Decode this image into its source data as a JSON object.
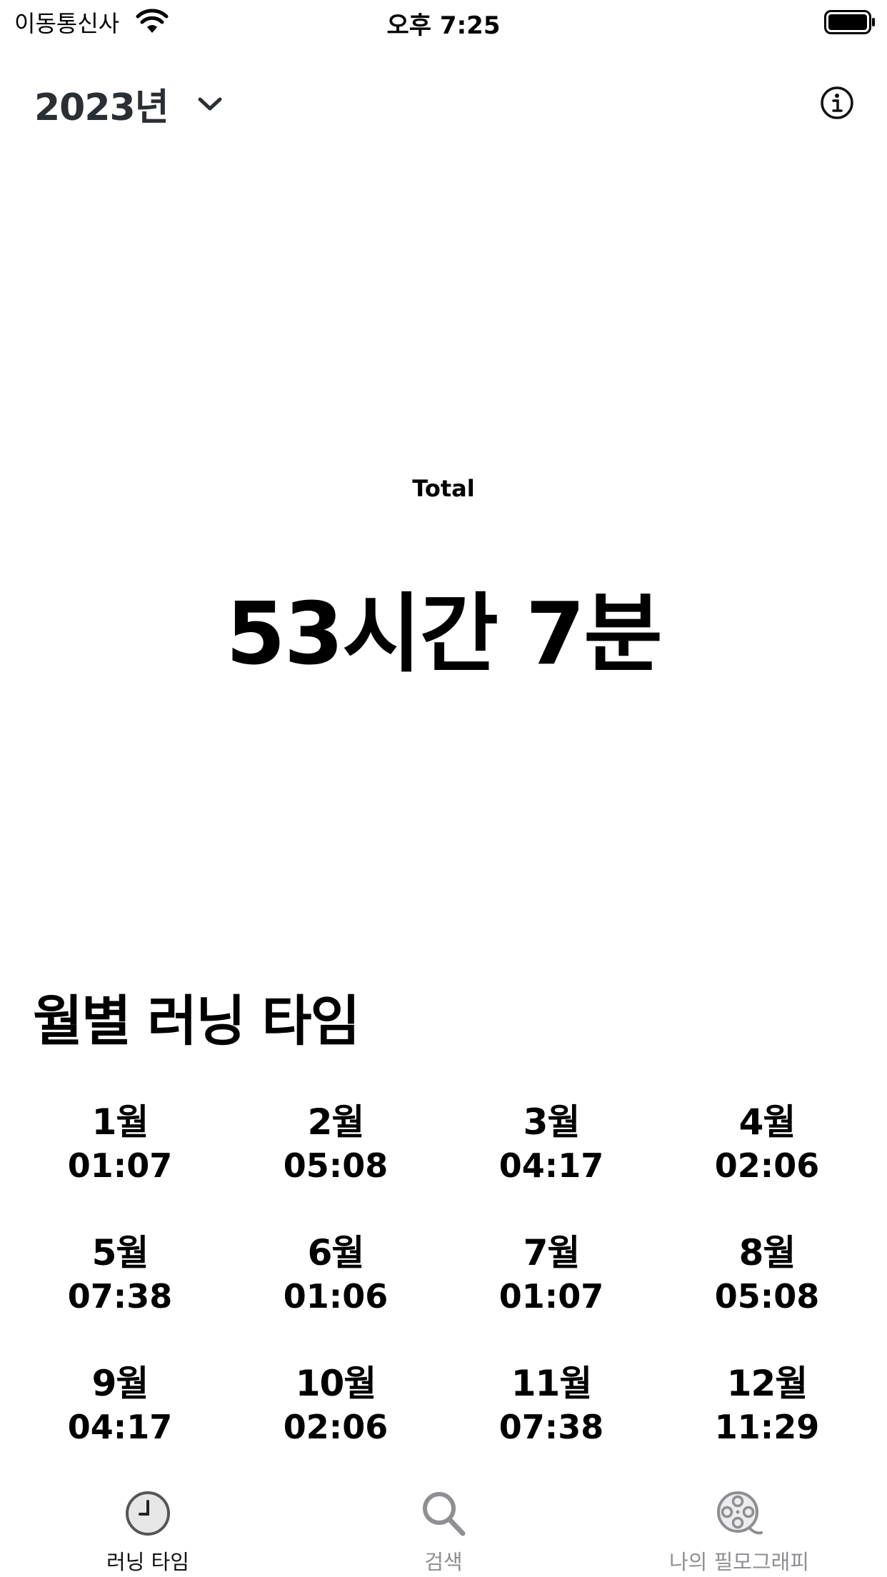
{
  "status_bar": {
    "carrier": "이동통신사",
    "time": "오후 7:25"
  },
  "header": {
    "year": "2023년"
  },
  "summary": {
    "caption": "Total",
    "value": "53시간 7분"
  },
  "monthly": {
    "title": "월별 러닝 타임",
    "months": [
      {
        "name": "1월",
        "time": "01:07"
      },
      {
        "name": "2월",
        "time": "05:08"
      },
      {
        "name": "3월",
        "time": "04:17"
      },
      {
        "name": "4월",
        "time": "02:06"
      },
      {
        "name": "5월",
        "time": "07:38"
      },
      {
        "name": "6월",
        "time": "01:06"
      },
      {
        "name": "7월",
        "time": "01:07"
      },
      {
        "name": "8월",
        "time": "05:08"
      },
      {
        "name": "9월",
        "time": "04:17"
      },
      {
        "name": "10월",
        "time": "02:06"
      },
      {
        "name": "11월",
        "time": "07:38"
      },
      {
        "name": "12월",
        "time": "11:29"
      }
    ]
  },
  "tabs": [
    {
      "label": "러닝 타임",
      "icon": "clock-icon",
      "active": true
    },
    {
      "label": "검색",
      "icon": "search-icon",
      "active": false
    },
    {
      "label": "나의 필모그래피",
      "icon": "film-reel-icon",
      "active": false
    }
  ]
}
